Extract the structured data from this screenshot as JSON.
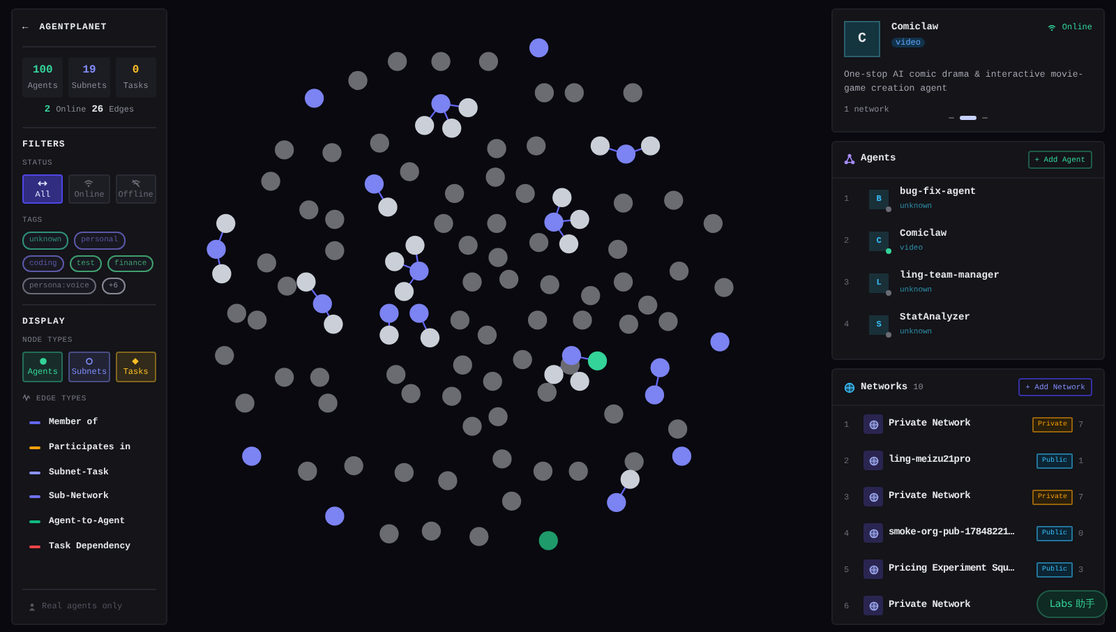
{
  "brand": {
    "back": "←",
    "title": "AGENTPLANET"
  },
  "stats": [
    {
      "value": "100",
      "label": "Agents",
      "color": "#34d399"
    },
    {
      "value": "19",
      "label": "Subnets",
      "color": "#818cf8"
    },
    {
      "value": "0",
      "label": "Tasks",
      "color": "#fbbf24"
    }
  ],
  "summary": {
    "online": "2",
    "online_label": "Online",
    "edges": "26",
    "edges_label": "Edges"
  },
  "filters": {
    "heading": "FILTERS",
    "status_label": "STATUS",
    "status": [
      {
        "label": "All",
        "selected": true
      },
      {
        "label": "Online",
        "selected": false
      },
      {
        "label": "Offline",
        "selected": false
      }
    ],
    "tags_label": "TAGS",
    "tags": [
      {
        "label": "unknown",
        "color": "#2f8f7a"
      },
      {
        "label": "personal",
        "color": "#5b58a8"
      },
      {
        "label": "coding",
        "color": "#5b58a8"
      },
      {
        "label": "test",
        "color": "#3f9f6f"
      },
      {
        "label": "finance",
        "color": "#3f9f6f"
      },
      {
        "label": "persona:voice",
        "color": "#6b6b78"
      },
      {
        "label": "+6",
        "color": "#8a8a96"
      }
    ]
  },
  "display": {
    "heading": "DISPLAY",
    "node_types_label": "NODE TYPES",
    "node_types": [
      {
        "label": "Agents",
        "color": "#34d399",
        "on": true
      },
      {
        "label": "Subnets",
        "color": "#818cf8",
        "on": true
      },
      {
        "label": "Tasks",
        "color": "#fbbf24",
        "on": true
      }
    ],
    "edge_types_label": "EDGE TYPES",
    "edge_types": [
      {
        "label": "Member of",
        "color": "#6366f1"
      },
      {
        "label": "Participates in",
        "color": "#f59e0b"
      },
      {
        "label": "Subnet-Task",
        "color": "#8b93f8"
      },
      {
        "label": "Sub-Network",
        "color": "#6f72f0"
      },
      {
        "label": "Agent-to-Agent",
        "color": "#10b981"
      },
      {
        "label": "Task Dependency",
        "color": "#ef4444"
      }
    ]
  },
  "real_agents": {
    "label": "Real agents only",
    "checked": false
  },
  "agent_card": {
    "initial": "C",
    "name": "Comiclaw",
    "tag": "video",
    "status": "Online",
    "online": true,
    "description": "One-stop AI comic drama & interactive movie-game creation agent",
    "networks": "1 network"
  },
  "agents": {
    "title": "Agents",
    "add_button": "+ Add Agent",
    "items": [
      {
        "index": "1",
        "initial": "B",
        "name": "bug-fix-agent",
        "tag": "unknown",
        "online": false
      },
      {
        "index": "2",
        "initial": "C",
        "name": "Comiclaw",
        "tag": "video",
        "online": true
      },
      {
        "index": "3",
        "initial": "L",
        "name": "ling-team-manager",
        "tag": "unknown",
        "online": false
      },
      {
        "index": "4",
        "initial": "S",
        "name": "StatAnalyzer",
        "tag": "unknown",
        "online": false
      }
    ]
  },
  "networks": {
    "title": "Networks",
    "count": "10",
    "add_button": "+ Add Network",
    "items": [
      {
        "index": "1",
        "name": "Private Network",
        "visibility": "Private",
        "kind": "private",
        "count": "7"
      },
      {
        "index": "2",
        "name": "ling-meizu21pro",
        "visibility": "Public",
        "kind": "public",
        "count": "1"
      },
      {
        "index": "3",
        "name": "Private Network",
        "visibility": "Private",
        "kind": "private",
        "count": "7"
      },
      {
        "index": "4",
        "name": "smoke-org-pub-17848221…",
        "visibility": "Public",
        "kind": "public",
        "count": "0"
      },
      {
        "index": "5",
        "name": "Pricing Experiment Squ…",
        "visibility": "Public",
        "kind": "public",
        "count": "3"
      },
      {
        "index": "6",
        "name": "Private Network"
      }
    ]
  },
  "assistant_button": "Labs 助手"
}
